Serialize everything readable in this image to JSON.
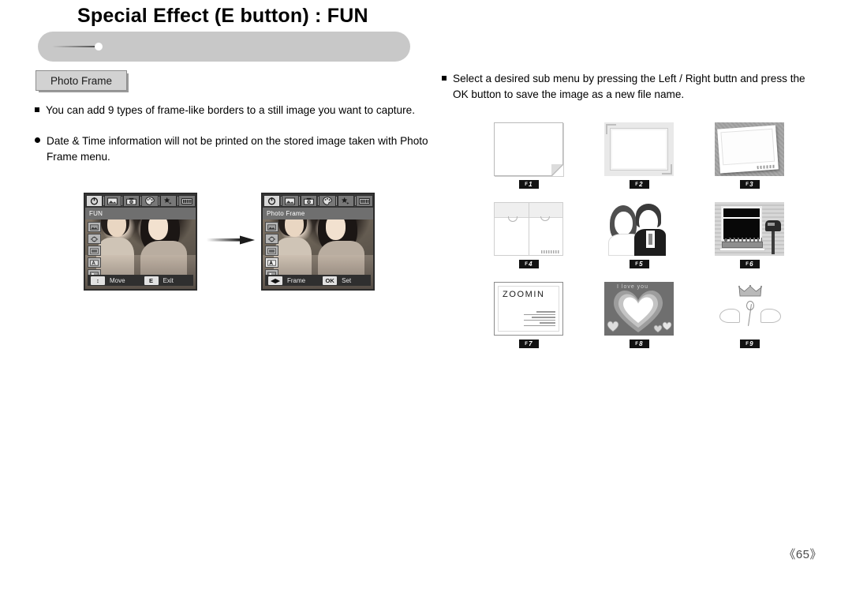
{
  "header": {
    "title": "Special Effect (E button) :  FUN",
    "tag_label": "Photo Frame"
  },
  "left_column": {
    "bullets": [
      {
        "marker": "square",
        "text": "You can add 9 types of frame-like borders to a still image you want to capture."
      },
      {
        "marker": "circle",
        "text": "Date & Time information will not be printed on the stored image taken with Photo Frame menu."
      }
    ]
  },
  "right_column": {
    "bullets": [
      {
        "marker": "square",
        "text": "Select a desired sub menu by pressing the Left / Right buttn and press the OK button to save the image as a new file name."
      }
    ]
  },
  "lcd_screens": [
    {
      "id": "lcd-fun",
      "title": "FUN",
      "tabs": [
        {
          "name": "fun-tab",
          "selected": true
        },
        {
          "name": "image-tab",
          "selected": false
        },
        {
          "name": "camera-tab",
          "selected": false
        },
        {
          "name": "palette-tab",
          "selected": false
        },
        {
          "name": "star-tab",
          "selected": false
        },
        {
          "name": "filmstrip-tab",
          "selected": false
        }
      ],
      "side_icons_count": 5,
      "selected_side_icon": -1,
      "highlight_circle": false,
      "bottom": [
        {
          "key": "↕",
          "label": "Move"
        },
        {
          "key": "E",
          "label": "Exit"
        }
      ]
    },
    {
      "id": "lcd-photo-frame",
      "title": "Photo Frame",
      "tabs": [
        {
          "name": "fun-tab",
          "selected": true
        },
        {
          "name": "image-tab",
          "selected": false
        },
        {
          "name": "camera-tab",
          "selected": false
        },
        {
          "name": "palette-tab",
          "selected": false
        },
        {
          "name": "star-tab",
          "selected": false
        },
        {
          "name": "filmstrip-tab",
          "selected": false
        }
      ],
      "side_icons_count": 5,
      "selected_side_icon": 3,
      "highlight_circle": true,
      "bottom": [
        {
          "key": "◀▶",
          "label": "Frame"
        },
        {
          "key": "OK",
          "label": "Set"
        }
      ]
    }
  ],
  "arrow": {
    "name": "right-arrow",
    "direction": "right"
  },
  "frame_samples": [
    {
      "badge_prefix": "F",
      "badge_num": "1",
      "style": "dog-ear"
    },
    {
      "badge_prefix": "F",
      "badge_num": "2",
      "style": "soft-border"
    },
    {
      "badge_prefix": "F",
      "badge_num": "3",
      "style": "polaroid-tilt"
    },
    {
      "badge_prefix": "F",
      "badge_num": "4",
      "style": "notebook"
    },
    {
      "badge_prefix": "F",
      "badge_num": "5",
      "style": "wedding-couple"
    },
    {
      "badge_prefix": "F",
      "badge_num": "6",
      "style": "window-mailbox"
    },
    {
      "badge_prefix": "F",
      "badge_num": "7",
      "style": "zoomin-card",
      "card_text": "ZOOMIN"
    },
    {
      "badge_prefix": "F",
      "badge_num": "8",
      "style": "hearts",
      "overlay_text": "I love you"
    },
    {
      "badge_prefix": "F",
      "badge_num": "9",
      "style": "crown-wings"
    }
  ],
  "footer": {
    "page_number": "《65》"
  },
  "colors": {
    "banner": "#c8c8c8",
    "tag": "#d2d2d2",
    "lcd_frame": "#2b2b2b",
    "badge": "#121212",
    "text": "#000000"
  }
}
